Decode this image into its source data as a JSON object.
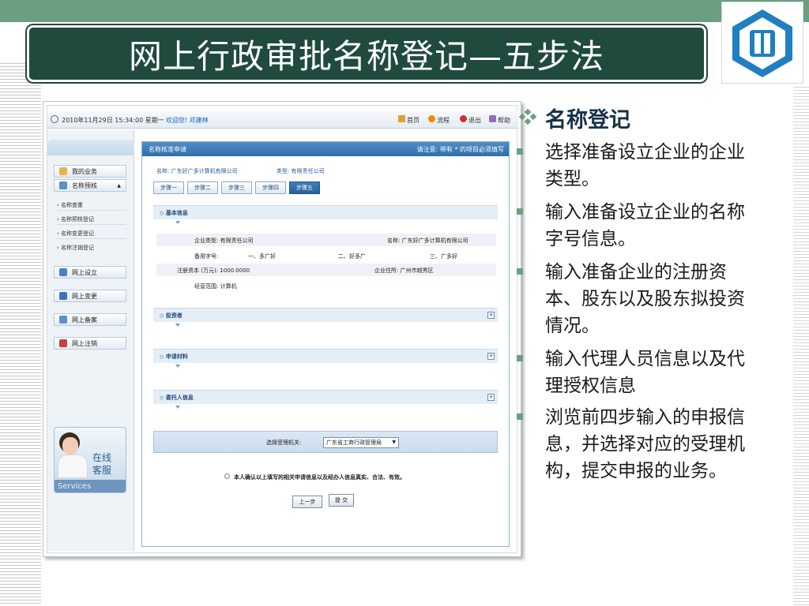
{
  "slide": {
    "title": "网上行政审批名称登记—五步法",
    "heading": "名称登记",
    "bullets": [
      "选择准备设立企业的企业类型。",
      "输入准备设立企业的名称字号信息。",
      "输入准备企业的注册资本、股东以及股东拟投资情况。",
      "输入代理人员信息以及代理授权信息",
      "浏览前四步输入的申报信息，并选择对应的受理机构，提交申报的业务。"
    ]
  },
  "app": {
    "datetime": "2010年11月29日 15:34:00 星期一",
    "welcome": "欢迎您! 邓建林",
    "nav": [
      "首页",
      "流程",
      "退出",
      "帮助"
    ],
    "sidebar": {
      "items": [
        "我的业务",
        "名称预核",
        "网上设立",
        "网上变更",
        "网上备案",
        "网上注销"
      ],
      "subitems": [
        "名称查重",
        "名称预核登记",
        "名称变更登记",
        "名称注销登记"
      ],
      "service_text": [
        "在线",
        "客服"
      ],
      "service_en": "Services"
    },
    "panel": {
      "title": "名称核准申请",
      "note": "请注意: 带有 * 的项目必须填写",
      "name_label": "名称: 广东好广多计算机有限公司",
      "type_label": "类型: 有限责任公司",
      "steps": [
        "步骤一",
        "步骤二",
        "步骤三",
        "步骤四",
        "步骤五"
      ],
      "sections": [
        "基本信息",
        "投资者",
        "申请材料",
        "委托人信息"
      ],
      "basic": {
        "company_type": "企业类型: 有限责任公司",
        "company_name": "名称: 广东好广多计算机有限公司",
        "alt_label": "备用字号:",
        "alt1": "一、多广好",
        "alt2": "二、好多广",
        "alt3": "三、广多好",
        "capital": "注册资本 (万元): 1000.0000",
        "address": "企业住所: 广州市越秀区",
        "scope": "经营范围: 计算机"
      },
      "org_label": "选择受理机关:",
      "org_value": "广东省工商行政管理局",
      "confirm": "本人确认以上填写的相关申请信息以及经办人信息真实、合法、有效。",
      "prev_btn": "上一步",
      "submit_btn": "提 交"
    }
  },
  "colors": {
    "title_bg": "#1f4a3d",
    "band": "#6a9f7f",
    "panel_head": "#2f6ea8",
    "logo": "#1f7fc0"
  }
}
